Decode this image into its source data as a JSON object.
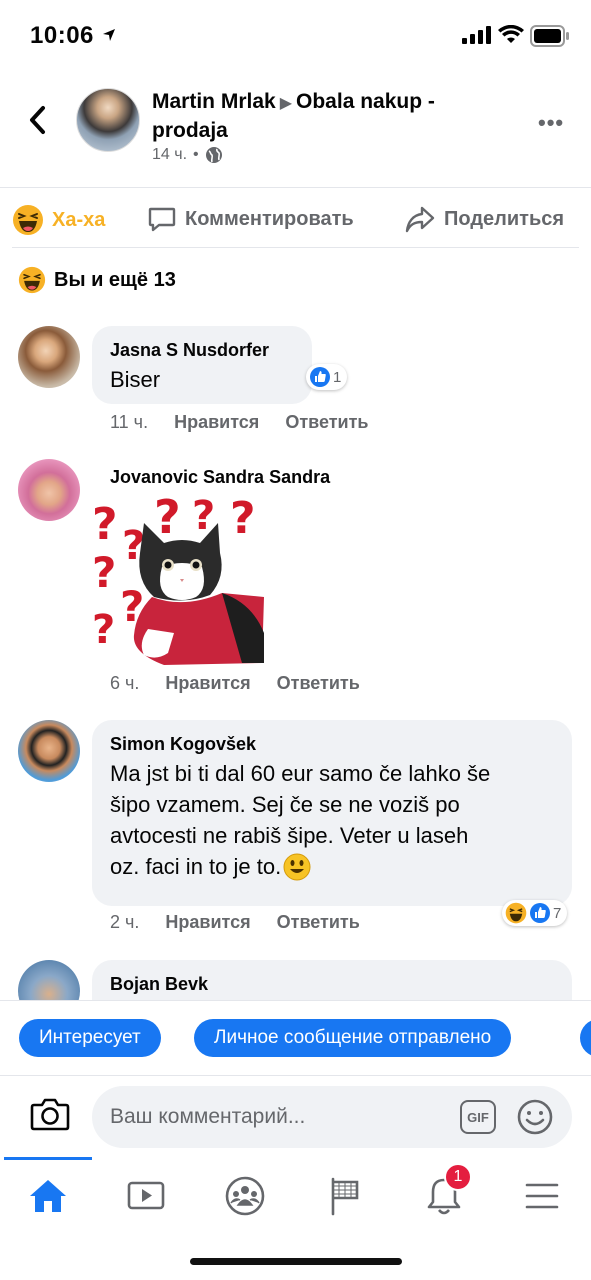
{
  "status": {
    "time": "10:06"
  },
  "post": {
    "author": "Martin Mrlak",
    "group": "Obala nakup - prodaja",
    "age": "14 ч.",
    "separator": "•"
  },
  "actions": {
    "react_label": "Ха-ха",
    "comment_label": "Комментировать",
    "share_label": "Поделиться"
  },
  "reactions_summary": "Вы и ещё 13",
  "comments": [
    {
      "name": "Jasna S Nusdorfer",
      "text": "Biser",
      "time": "11 ч.",
      "like": "Нравится",
      "reply": "Ответить",
      "reaction_count": "1"
    },
    {
      "name": "Jovanovic Sandra Sandra",
      "time": "6 ч.",
      "like": "Нравится",
      "reply": "Ответить"
    },
    {
      "name": "Simon Kogovšek",
      "text_lines": [
        "Ma jst bi ti dal 60 eur samo če lahko še",
        "šipo vzamem. Sej če se ne voziš po",
        "avtocesti ne rabiš šipe. Veter u laseh",
        "oz. faci in to je to."
      ],
      "time": "2 ч.",
      "like": "Нравится",
      "reply": "Ответить",
      "reaction_count": "7"
    },
    {
      "name": "Bojan Bevk"
    }
  ],
  "chips": [
    "Интересует",
    "Личное сообщение отправлено"
  ],
  "composer": {
    "placeholder": "Ваш комментарий...",
    "gif_label": "GIF"
  },
  "tabs": {
    "notifications_badge": "1"
  },
  "colors": {
    "accent": "#1877f2",
    "haha": "#f7b125",
    "badge": "#e41e3f"
  }
}
